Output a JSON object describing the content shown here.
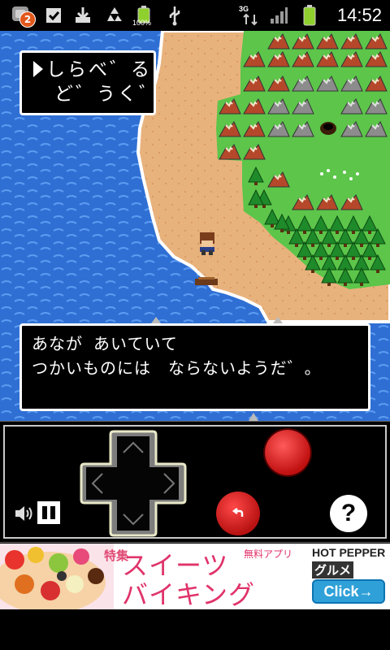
{
  "status_bar": {
    "notification_count": "2",
    "battery_percent": "100%",
    "network_type": "3G",
    "time": "14:52",
    "icons": [
      "app-notification-icon",
      "checkbox-icon",
      "download-icon",
      "recycle-icon",
      "battery-icon",
      "usb-icon",
      "3g-icon",
      "signal-icon",
      "battery-icon"
    ]
  },
  "game": {
    "command_menu": {
      "items": [
        "しらべる",
        "どうぐ"
      ],
      "items_display": [
        "しらべ゛る",
        "ど゛うく゛"
      ],
      "selected_index": 0
    },
    "message": {
      "lines": [
        "あながあいていて",
        "つかいものにはならないようだ。"
      ],
      "lines_display": [
        "あなが あいていて",
        "つかいものには　ならないようだ゛。"
      ]
    }
  },
  "controller": {
    "icons": [
      "dpad-up-icon",
      "dpad-down-icon",
      "dpad-left-icon",
      "dpad-right-icon",
      "action-button-icon",
      "back-arrow-icon",
      "help-question-icon",
      "volume-icon",
      "pause-icon"
    ],
    "colors": {
      "action_red": "#d81d1d",
      "frame": "#c9c9c9",
      "dpad": "#7d7d7d"
    }
  },
  "ad": {
    "tag": "特集",
    "headline_1": "スイーツ",
    "headline_2": "バイキング",
    "app_label": "無料アプリ",
    "brand": "HOT PEPPER",
    "brand_sub": "グルメ",
    "cta": "Click→"
  },
  "colors": {
    "sea": "#2e6fd6",
    "sand": "#e8b27d",
    "grass": "#5cc54a",
    "window_border": "#ffffff"
  }
}
